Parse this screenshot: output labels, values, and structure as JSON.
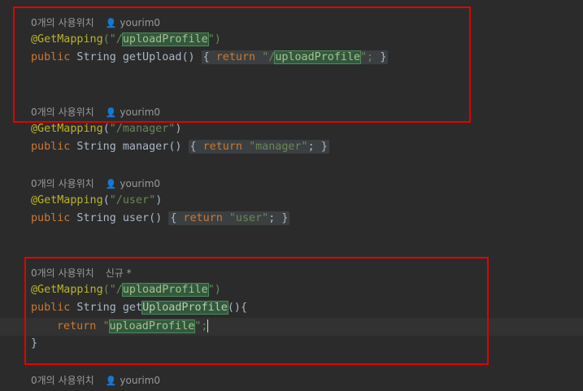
{
  "blocks": [
    {
      "hint": {
        "usage": "0개의 사용위치",
        "user": "yourim0"
      },
      "annotation": {
        "name": "@GetMapping",
        "open": "(\"/",
        "path": "uploadProfile",
        "close": "\")"
      },
      "method": {
        "kw": "public",
        "type": " String ",
        "name": "getUpload",
        "parens": "()",
        "space": " ",
        "lbrace": "{",
        "ret": " return ",
        "qopen": "\"/",
        "value": "uploadProfile",
        "qclose": "\";",
        "rbrace": "}"
      }
    },
    {
      "hint": {
        "usage": "0개의 사용위치",
        "user": "yourim0"
      },
      "annotation": {
        "name": "@GetMapping",
        "open": "(",
        "path": "\"/manager\"",
        "close": ")"
      },
      "method": {
        "kw": "public",
        "type": " String ",
        "name": "manager",
        "parens": "()",
        "space": " ",
        "lbrace": "{",
        "ret": " return ",
        "value": "\"manager\"",
        "semi": ";",
        "rbrace": "}"
      }
    },
    {
      "hint": {
        "usage": "0개의 사용위치",
        "user": "yourim0"
      },
      "annotation": {
        "name": "@GetMapping",
        "open": "(",
        "path": "\"/user\"",
        "close": ")"
      },
      "method": {
        "kw": "public",
        "type": " String ",
        "name": "user",
        "parens": "()",
        "space": " ",
        "lbrace": "{",
        "ret": " return ",
        "value": "\"user\"",
        "semi": ";",
        "rbrace": "}"
      }
    },
    {
      "hint": {
        "usage": "0개의 사용위치",
        "new": "신규 *"
      },
      "annotation": {
        "name": "@GetMapping",
        "open": "(\"/",
        "path": "uploadProfile",
        "close": "\")"
      },
      "method": {
        "kw": "public",
        "type": " String ",
        "prefix": "get",
        "name": "UploadProfile",
        "parens": "(){"
      },
      "body": {
        "ret": "return ",
        "qopen": "\"",
        "value": "uploadProfile",
        "qclose": "\";"
      },
      "end": "}"
    },
    {
      "hint": {
        "usage": "0개의 사용위치",
        "user": "yourim0"
      }
    }
  ],
  "colors": {
    "keyword": "#cc7832",
    "annotation": "#bbb529",
    "string": "#6a8759",
    "highlight_box": "#e50000",
    "background": "#2b2b2b"
  }
}
